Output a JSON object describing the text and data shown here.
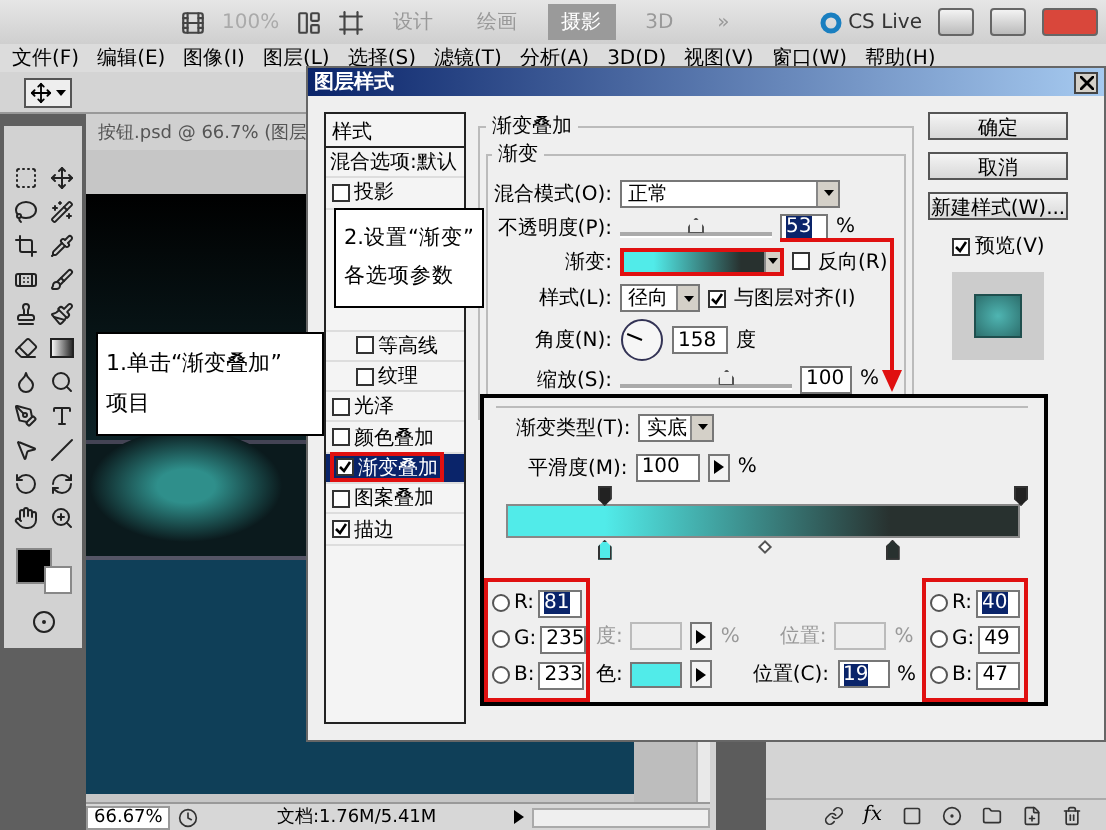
{
  "top_bar": {
    "zoom": "100%",
    "workspaces": [
      {
        "label": "设计",
        "selected": false
      },
      {
        "label": "绘画",
        "selected": false
      },
      {
        "label": "摄影",
        "selected": true
      },
      {
        "label": "3D",
        "selected": false
      }
    ],
    "more": "»",
    "cs_live": "CS Live"
  },
  "menu": [
    "文件(F)",
    "编辑(E)",
    "图像(I)",
    "图层(L)",
    "选择(S)",
    "滤镜(T)",
    "分析(A)",
    "3D(D)",
    "视图(V)",
    "窗口(W)",
    "帮助(H)"
  ],
  "document": {
    "tab": "按钮.psd @ 66.7% (图层",
    "zoom": "66.67%",
    "doc_info": "文档:1.76M/5.41M"
  },
  "layers_panel": {
    "fx": "fx"
  },
  "dialog": {
    "title": "图层样式",
    "styles_header": "样式",
    "blend_options": "混合选项:默认",
    "styles": [
      {
        "label": "投影",
        "checked": false,
        "selected": false
      },
      {
        "children": [
          {
            "label": "等高线",
            "checked": false,
            "selected": false
          },
          {
            "label": "纹理",
            "checked": false,
            "selected": false
          }
        ]
      },
      {
        "label": "光泽",
        "checked": false,
        "selected": false
      },
      {
        "label": "颜色叠加",
        "checked": false,
        "selected": false
      },
      {
        "label": "渐变叠加",
        "checked": true,
        "selected": true
      },
      {
        "label": "图案叠加",
        "checked": false,
        "selected": false
      },
      {
        "label": "描边",
        "checked": true,
        "selected": false
      }
    ],
    "section_title": "渐变叠加",
    "group_title": "渐变",
    "blend_mode": {
      "label": "混合模式(O):",
      "value": "正常"
    },
    "opacity": {
      "label": "不透明度(P):",
      "level": 0.5,
      "value": "53",
      "unit": "%"
    },
    "gradient": {
      "label": "渐变:"
    },
    "reverse": {
      "label": "反向(R)",
      "checked": false
    },
    "style": {
      "label": "样式(L):",
      "value": "径向"
    },
    "align": {
      "label": "与图层对齐(I)",
      "checked": true
    },
    "angle": {
      "label": "角度(N):",
      "value": "158",
      "unit": "度"
    },
    "scale": {
      "label": "缩放(S):",
      "level": 0.62,
      "value": "100",
      "unit": "%"
    },
    "buttons": [
      "确定",
      "取消",
      "新建样式(W)..."
    ],
    "preview": {
      "label": "预览(V)",
      "checked": true
    }
  },
  "gradient_editor": {
    "type_label": "渐变类型(T):",
    "type_value": "实底",
    "smoothness_label": "平滑度(M):",
    "smoothness": "100",
    "smoothness_unit": "%",
    "opacity_stops": [
      {
        "level": 0.19
      },
      {
        "level": 1
      }
    ],
    "color_stops": [
      {
        "level": 0.19,
        "color": "#51ebe9"
      },
      {
        "level": 0.75,
        "color": "#28312f"
      }
    ],
    "midpoint": {
      "level": 0.5
    },
    "rgb_left": [
      {
        "label": "R:",
        "value": "81",
        "selected": false
      },
      {
        "label": "G:",
        "value": "235",
        "selected": false
      },
      {
        "label": "B:",
        "value": "233",
        "selected": false
      }
    ],
    "rgb_right": [
      {
        "label": "R:",
        "value": "40",
        "selected": false
      },
      {
        "label": "G:",
        "value": "49",
        "selected": false
      },
      {
        "label": "B:",
        "value": "47",
        "selected": false
      }
    ],
    "stop_opacity": {
      "label": "度:",
      "unit": "%",
      "disabled": true
    },
    "stop_opacity_location": {
      "label": "位置:",
      "unit": "%",
      "disabled": true
    },
    "stop_color": {
      "label": "色:",
      "color": "#51ebe9"
    },
    "stop_location": {
      "label": "位置(C):",
      "value": "19",
      "unit": "%"
    }
  },
  "callouts": [
    {
      "text": "2.设置“渐变”\n各选项参数"
    },
    {
      "text": "1.单击“渐变叠加”\n项目"
    }
  ]
}
